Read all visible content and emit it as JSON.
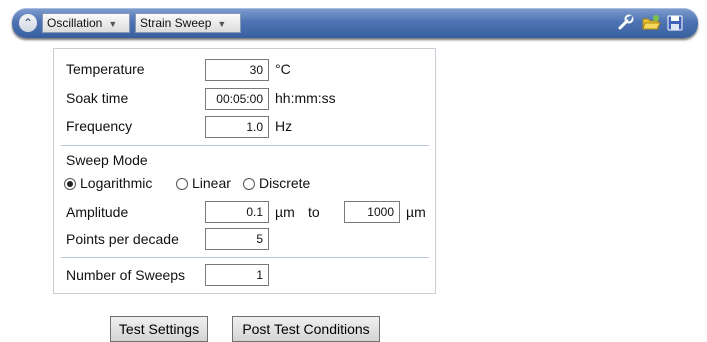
{
  "toolbar": {
    "mode_select": "Oscillation",
    "test_select": "Strain Sweep",
    "icons": [
      "collapse-chevron-icon",
      "wrench-icon",
      "folder-open-icon",
      "save-disk-icon"
    ]
  },
  "conditions": {
    "temperature": {
      "label": "Temperature",
      "value": "30",
      "unit": "°C"
    },
    "soak_time": {
      "label": "Soak time",
      "value": "00:05:00",
      "unit": "hh:mm:ss"
    },
    "frequency": {
      "label": "Frequency",
      "value": "1.0",
      "unit": "Hz"
    }
  },
  "sweep": {
    "title": "Sweep Mode",
    "modes": [
      {
        "label": "Logarithmic",
        "selected": true
      },
      {
        "label": "Linear",
        "selected": false
      },
      {
        "label": "Discrete",
        "selected": false
      }
    ],
    "amplitude": {
      "label": "Amplitude",
      "from": "0.1",
      "from_unit": "µm",
      "to_label": "to",
      "to": "1000",
      "to_unit": "µm"
    },
    "points": {
      "label": "Points per decade",
      "value": "5"
    }
  },
  "sweeps": {
    "label": "Number of Sweeps",
    "value": "1"
  },
  "buttons": {
    "test_settings": "Test Settings",
    "post_test": "Post Test Conditions"
  }
}
